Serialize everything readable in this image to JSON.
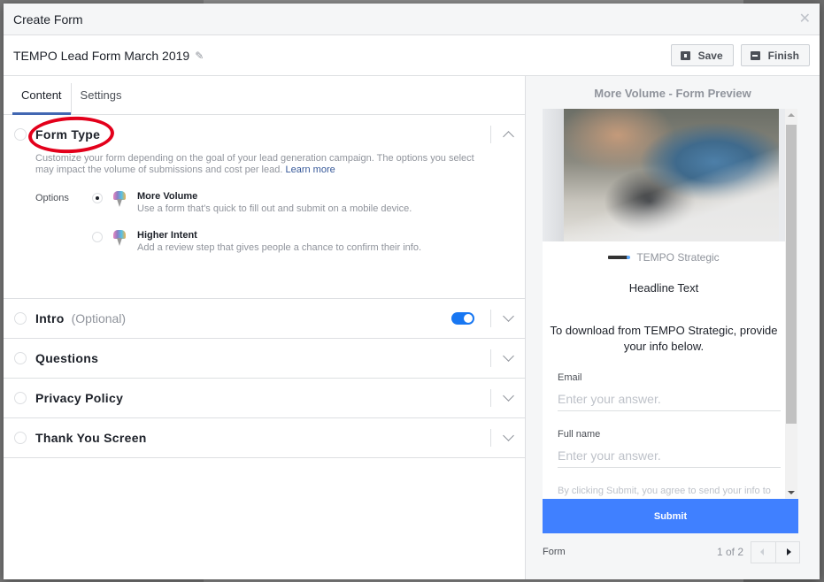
{
  "window": {
    "title": "Create Form",
    "close_icon": "close-icon"
  },
  "form": {
    "name": "TEMPO Lead Form March 2019",
    "edit_icon": "pencil-icon"
  },
  "toolbar": {
    "save_label": "Save",
    "finish_label": "Finish"
  },
  "tabs": [
    {
      "label": "Content",
      "active": true
    },
    {
      "label": "Settings",
      "active": false
    }
  ],
  "form_type": {
    "title": "Form Type",
    "description": "Customize your form depending on the goal of your lead generation campaign. The options you select may impact the volume of submissions and cost per lead.",
    "learn_more": "Learn more",
    "options_label": "Options",
    "options": [
      {
        "title": "More Volume",
        "description": "Use a form that's quick to fill out and submit on a mobile device.",
        "selected": true
      },
      {
        "title": "Higher Intent",
        "description": "Add a review step that gives people a chance to confirm their info.",
        "selected": false
      }
    ]
  },
  "sections": [
    {
      "title": "Intro",
      "optional": "(Optional)",
      "toggle_on": true
    },
    {
      "title": "Questions"
    },
    {
      "title": "Privacy Policy"
    },
    {
      "title": "Thank You Screen"
    }
  ],
  "preview": {
    "title": "More Volume - Form Preview",
    "brand": "TEMPO Strategic",
    "headline": "Headline Text",
    "body": "To download from TEMPO Strategic, provide your info below.",
    "fields": [
      {
        "label": "Email",
        "placeholder": "Enter your answer."
      },
      {
        "label": "Full name",
        "placeholder": "Enter your answer."
      }
    ],
    "disclaimer": "By clicking Submit, you agree to send your info to",
    "submit_label": "Submit",
    "footer_label": "Form",
    "pager": "1 of 2",
    "accent_color": "#4080ff"
  }
}
